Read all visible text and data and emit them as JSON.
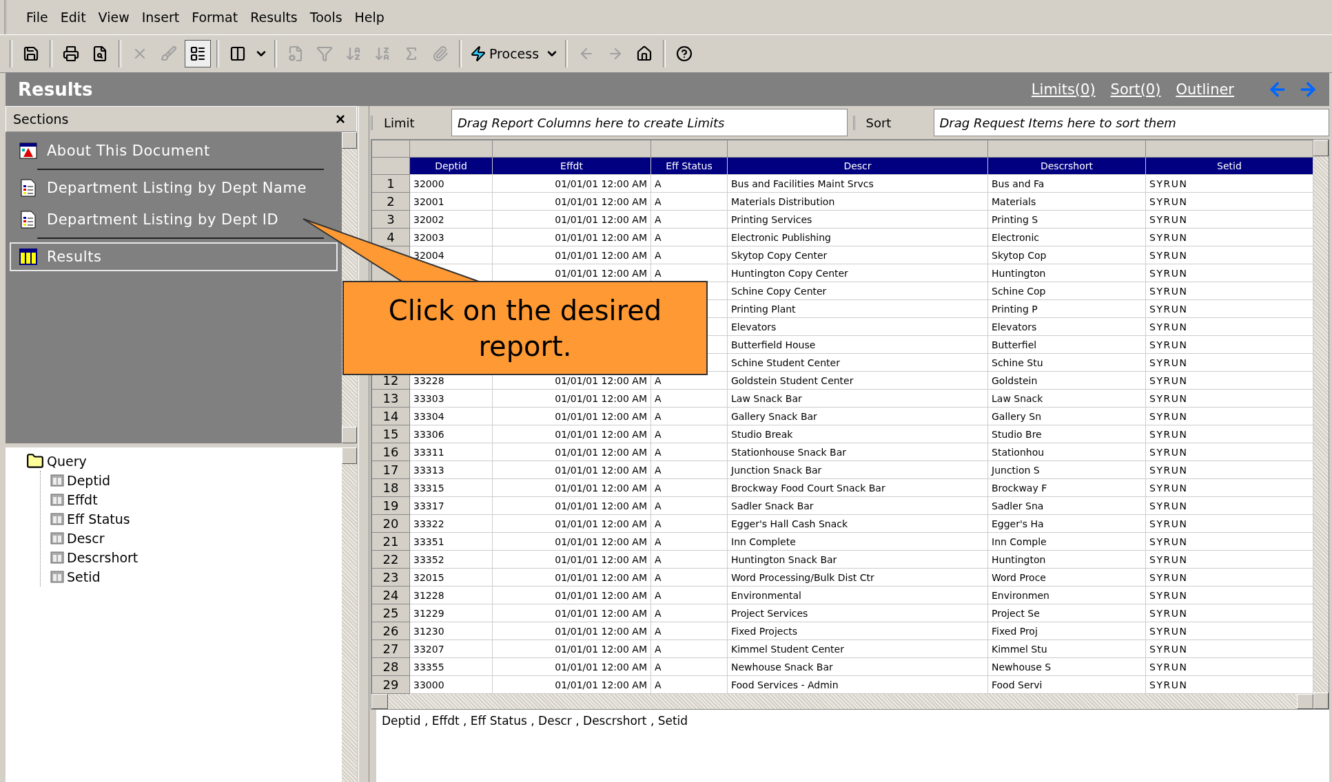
{
  "menu": [
    "File",
    "Edit",
    "View",
    "Insert",
    "Format",
    "Results",
    "Tools",
    "Help"
  ],
  "toolbar": [
    {
      "kind": "separator"
    },
    {
      "kind": "icon",
      "disabled": false,
      "selected": false
    },
    {
      "kind": "separator"
    },
    {
      "kind": "icon",
      "disabled": false,
      "selected": false
    },
    {
      "kind": "icon",
      "disabled": false,
      "selected": false
    },
    {
      "kind": "separator"
    },
    {
      "kind": "icon",
      "disabled": true,
      "selected": false
    },
    {
      "kind": "icon",
      "disabled": true,
      "selected": false
    },
    {
      "kind": "icon",
      "disabled": false,
      "selected": true
    },
    {
      "kind": "separator"
    },
    {
      "kind": "icon",
      "disabled": false,
      "selected": false
    },
    {
      "kind": "dropdown",
      "disabled": false
    },
    {
      "kind": "separator"
    },
    {
      "kind": "icon",
      "disabled": true,
      "selected": false
    },
    {
      "kind": "icon",
      "disabled": true,
      "selected": false
    },
    {
      "kind": "icon",
      "disabled": true,
      "selected": false
    },
    {
      "kind": "icon",
      "disabled": true,
      "selected": false
    },
    {
      "kind": "icon",
      "disabled": true,
      "selected": false
    },
    {
      "kind": "icon",
      "disabled": true,
      "selected": false
    },
    {
      "kind": "separator"
    },
    {
      "kind": "process",
      "label": "Process",
      "disabled": false
    },
    {
      "kind": "dropdown",
      "disabled": false
    },
    {
      "kind": "separator"
    },
    {
      "kind": "icon",
      "disabled": true,
      "selected": false
    },
    {
      "kind": "icon",
      "disabled": true,
      "selected": false
    },
    {
      "kind": "icon",
      "disabled": false,
      "selected": false
    },
    {
      "kind": "separator"
    },
    {
      "kind": "icon",
      "disabled": false,
      "selected": false
    }
  ],
  "section_title": "Results",
  "header_links": [
    "Limits(0)",
    "Sort(0)",
    "Outliner"
  ],
  "sections": {
    "title": "Sections",
    "close": "×",
    "groups": [
      [
        {
          "kind": "document",
          "label": "About This Document",
          "selected": false
        }
      ],
      [
        {
          "kind": "report",
          "label": "Department Listing by Dept Name",
          "selected": false
        },
        {
          "kind": "report",
          "label": "Department Listing by Dept ID",
          "selected": false
        }
      ],
      [
        {
          "kind": "results",
          "label": "Results",
          "selected": true
        }
      ]
    ]
  },
  "tree": {
    "label": "Query",
    "expanded": true,
    "children": [
      {
        "label": "Deptid"
      },
      {
        "label": "Effdt"
      },
      {
        "label": "Eff Status"
      },
      {
        "label": "Descr"
      },
      {
        "label": "Descrshort"
      },
      {
        "label": "Setid"
      }
    ]
  },
  "limit_bar": {
    "label": "Limit",
    "hint": "Drag Report Columns here to create Limits"
  },
  "sort_bar": {
    "label": "Sort",
    "hint": "Drag Request Items here to sort them"
  },
  "table": {
    "columns": [
      "Deptid",
      "Effdt",
      "Eff Status",
      "Descr",
      "Descrshort",
      "Setid"
    ],
    "rows": [
      {
        "num": "1",
        "cells": [
          "32000",
          "01/01/01 12:00 AM",
          "A",
          "Bus and Facilities Maint Srvcs",
          "Bus and Fa",
          "SYRUN"
        ]
      },
      {
        "num": "2",
        "cells": [
          "32001",
          "01/01/01 12:00 AM",
          "A",
          "Materials Distribution",
          "Materials",
          "SYRUN"
        ]
      },
      {
        "num": "3",
        "cells": [
          "32002",
          "01/01/01 12:00 AM",
          "A",
          "Printing Services",
          "Printing S",
          "SYRUN"
        ]
      },
      {
        "num": "4",
        "cells": [
          "32003",
          "01/01/01 12:00 AM",
          "A",
          "Electronic Publishing",
          "Electronic",
          "SYRUN"
        ]
      },
      {
        "cells": [
          "32004",
          "01/01/01 12:00 AM",
          "A",
          "Skytop Copy Center",
          "Skytop Cop",
          "SYRUN"
        ]
      },
      {
        "cells": [
          "",
          "01/01/01 12:00 AM",
          "A",
          "Huntington Copy Center",
          "Huntington",
          "SYRUN"
        ]
      },
      {
        "cells": [
          "",
          "",
          "",
          "Schine Copy Center",
          "Schine Cop",
          "SYRUN"
        ]
      },
      {
        "cells": [
          "",
          "",
          "",
          "Printing Plant",
          "Printing P",
          "SYRUN"
        ]
      },
      {
        "cells": [
          "",
          "",
          "",
          "Elevators",
          "Elevators",
          "SYRUN"
        ]
      },
      {
        "cells": [
          "",
          "",
          "",
          "Butterfield House",
          "Butterfiel",
          "SYRUN"
        ]
      },
      {
        "cells": [
          "",
          "",
          "",
          "Schine Student Center",
          "Schine Stu",
          "SYRUN"
        ]
      },
      {
        "num": "12",
        "cells": [
          "33228",
          "01/01/01 12:00 AM",
          "A",
          "Goldstein Student Center",
          "Goldstein",
          "SYRUN"
        ]
      },
      {
        "num": "13",
        "cells": [
          "33303",
          "01/01/01 12:00 AM",
          "A",
          "Law Snack Bar",
          "Law Snack",
          "SYRUN"
        ]
      },
      {
        "num": "14",
        "cells": [
          "33304",
          "01/01/01 12:00 AM",
          "A",
          "Gallery Snack Bar",
          "Gallery Sn",
          "SYRUN"
        ]
      },
      {
        "num": "15",
        "cells": [
          "33306",
          "01/01/01 12:00 AM",
          "A",
          "Studio Break",
          "Studio Bre",
          "SYRUN"
        ]
      },
      {
        "num": "16",
        "cells": [
          "33311",
          "01/01/01 12:00 AM",
          "A",
          "Stationhouse Snack Bar",
          "Stationhou",
          "SYRUN"
        ]
      },
      {
        "num": "17",
        "cells": [
          "33313",
          "01/01/01 12:00 AM",
          "A",
          "Junction Snack Bar",
          "Junction S",
          "SYRUN"
        ]
      },
      {
        "num": "18",
        "cells": [
          "33315",
          "01/01/01 12:00 AM",
          "A",
          "Brockway Food Court Snack Bar",
          "Brockway F",
          "SYRUN"
        ]
      },
      {
        "num": "19",
        "cells": [
          "33317",
          "01/01/01 12:00 AM",
          "A",
          "Sadler Snack Bar",
          "Sadler Sna",
          "SYRUN"
        ]
      },
      {
        "num": "20",
        "cells": [
          "33322",
          "01/01/01 12:00 AM",
          "A",
          "Egger's Hall Cash Snack",
          "Egger's Ha",
          "SYRUN"
        ]
      },
      {
        "num": "21",
        "cells": [
          "33351",
          "01/01/01 12:00 AM",
          "A",
          "Inn Complete",
          "Inn Comple",
          "SYRUN"
        ]
      },
      {
        "num": "22",
        "cells": [
          "33352",
          "01/01/01 12:00 AM",
          "A",
          "Huntington Snack Bar",
          "Huntington",
          "SYRUN"
        ]
      },
      {
        "num": "23",
        "cells": [
          "32015",
          "01/01/01 12:00 AM",
          "A",
          "Word Processing/Bulk Dist Ctr",
          "Word Proce",
          "SYRUN"
        ]
      },
      {
        "num": "24",
        "cells": [
          "31228",
          "01/01/01 12:00 AM",
          "A",
          "Environmental",
          "Environmen",
          "SYRUN"
        ]
      },
      {
        "num": "25",
        "cells": [
          "31229",
          "01/01/01 12:00 AM",
          "A",
          "Project Services",
          "Project Se",
          "SYRUN"
        ]
      },
      {
        "num": "26",
        "cells": [
          "31230",
          "01/01/01 12:00 AM",
          "A",
          "Fixed Projects",
          "Fixed Proj",
          "SYRUN"
        ]
      },
      {
        "num": "27",
        "cells": [
          "33207",
          "01/01/01 12:00 AM",
          "A",
          "Kimmel Student Center",
          "Kimmel Stu",
          "SYRUN"
        ]
      },
      {
        "num": "28",
        "cells": [
          "33355",
          "01/01/01 12:00 AM",
          "A",
          "Newhouse Snack Bar",
          "Newhouse S",
          "SYRUN"
        ]
      },
      {
        "num": "29",
        "cells": [
          "33000",
          "01/01/01 12:00 AM",
          "A",
          "Food Services - Admin",
          "Food Servi",
          "SYRUN"
        ]
      }
    ]
  },
  "request_line": "Deptid , Effdt , Eff Status , Descr , Descrshort , Setid",
  "callout": "Click on the desired report."
}
